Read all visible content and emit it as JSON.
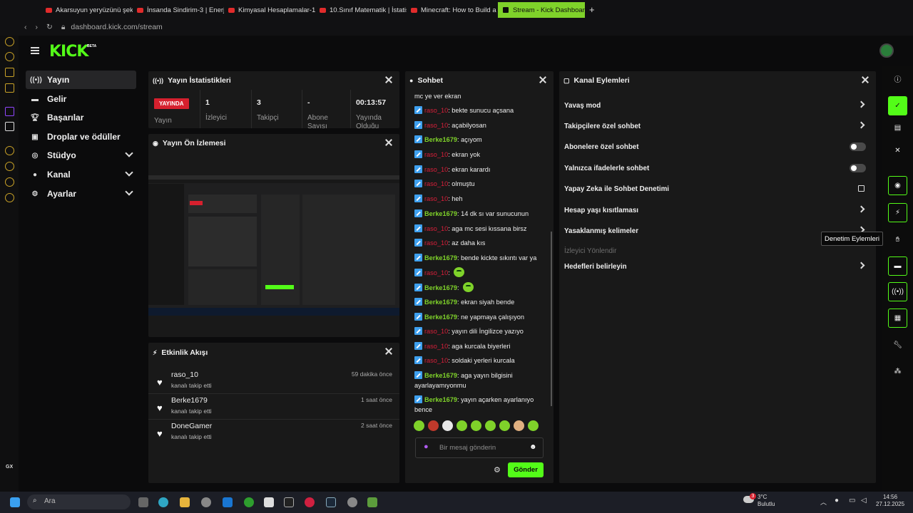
{
  "browser": {
    "tabs": [
      {
        "label": "Akarsuyun yeryüzünü şek"
      },
      {
        "label": "İnsanda Sindirim-3 | Enerj"
      },
      {
        "label": "Kimyasal Hesaplamalar-1"
      },
      {
        "label": "10.Sınıf Matematik | İstatis"
      },
      {
        "label": "Minecraft: How to Build a"
      },
      {
        "label": "Stream - Kick Dashboard"
      }
    ],
    "url": "dashboard.kick.com/stream"
  },
  "header": {
    "logo": "KICK",
    "beta": "BETA"
  },
  "sidebar": {
    "items": [
      {
        "label": "Yayın",
        "icon": "broadcast-icon"
      },
      {
        "label": "Gelir",
        "icon": "wallet-icon"
      },
      {
        "label": "Başarılar",
        "icon": "trophy-icon"
      },
      {
        "label": "Droplar ve ödüller",
        "icon": "gift-icon"
      },
      {
        "label": "Stüdyo",
        "icon": "studio-icon"
      },
      {
        "label": "Kanal",
        "icon": "user-icon"
      },
      {
        "label": "Ayarlar",
        "icon": "gear-icon"
      }
    ]
  },
  "stats": {
    "title": "Yayın İstatistikleri",
    "live": "YAYINDA",
    "live_label": "Yayın",
    "cells": [
      {
        "value": "1",
        "label": "İzleyici"
      },
      {
        "value": "3",
        "label": "Takipçi"
      },
      {
        "value": "-",
        "label": "Abone Sayısı"
      },
      {
        "value": "00:13:57",
        "label": "Yayında Olduğu"
      }
    ]
  },
  "preview": {
    "title": "Yayın Ön İzlemesi"
  },
  "activity": {
    "title": "Etkinlik Akışı",
    "items": [
      {
        "name": "raso_10",
        "sub": "kanalı takip etti",
        "time": "59 dakika önce"
      },
      {
        "name": "Berke1679",
        "sub": "kanalı takip etti",
        "time": "1 saat önce"
      },
      {
        "name": "DoneGamer",
        "sub": "kanalı takip etti",
        "time": "2 saat önce"
      }
    ]
  },
  "chat": {
    "title": "Sohbet",
    "first": "mc ye ver ekran",
    "messages": [
      {
        "user": "raso_10",
        "text": ": bekte sunucu açsana"
      },
      {
        "user": "raso_10",
        "text": ": açabilyosan"
      },
      {
        "user": "Berke1679",
        "text": ": açıyom"
      },
      {
        "user": "raso_10",
        "text": ": ekran yok"
      },
      {
        "user": "raso_10",
        "text": ": ekran karardı"
      },
      {
        "user": "raso_10",
        "text": ": olmuştu"
      },
      {
        "user": "raso_10",
        "text": ": heh"
      },
      {
        "user": "Berke1679",
        "text": ": 14 dk sı var sunucunun"
      },
      {
        "user": "raso_10",
        "text": ": aga mc sesi kıssana birsz"
      },
      {
        "user": "raso_10",
        "text": ": az daha kıs"
      },
      {
        "user": "Berke1679",
        "text": ": bende kickte sıkıntı var ya"
      },
      {
        "user": "raso_10",
        "text": ":"
      },
      {
        "user": "Berke1679",
        "text": ":"
      },
      {
        "user": "Berke1679",
        "text": ": ekran siyah bende"
      },
      {
        "user": "Berke1679",
        "text": ": ne yapmaya çalışıyon"
      },
      {
        "user": "raso_10",
        "text": ": yayın dili İngilizce yazıyo"
      },
      {
        "user": "raso_10",
        "text": ": aga kurcala biyerleri"
      },
      {
        "user": "raso_10",
        "text": ": soldaki yerleri kurcala"
      },
      {
        "user": "Berke1679",
        "text": ": aga yayın bilgisini ayarlayamıyonmu"
      },
      {
        "user": "Berke1679",
        "text": ": yayın açarken ayarlanıyo bence"
      }
    ],
    "placeholder": "Bir mesaj gönderin",
    "send": "Gönder"
  },
  "channel": {
    "title": "Kanal Eylemleri",
    "items": [
      {
        "label": "Yavaş mod",
        "control": "arrow"
      },
      {
        "label": "Takipçilere özel sohbet",
        "control": "arrow"
      },
      {
        "label": "Abonelere özel sohbet",
        "control": "toggle"
      },
      {
        "label": "Yalnızca ifadelerle sohbet",
        "control": "toggle"
      },
      {
        "label": "Yapay Zeka ile Sohbet Denetimi",
        "control": "external"
      },
      {
        "label": "Hesap yaşı kısıtlaması",
        "control": "arrow"
      },
      {
        "label": "Yasaklanmış kelimeler",
        "control": "arrow"
      },
      {
        "label": "İzleyici Yönlendir",
        "control": "none"
      },
      {
        "label": "Hedefleri belirleyin",
        "control": "arrow"
      }
    ]
  },
  "tooltip": "Denetim Eylemleri",
  "taskbar": {
    "search": "Ara",
    "weather_temp": "3°C",
    "weather_desc": "Bulutlu",
    "time": "14:56",
    "date": "27.12.2025",
    "badge": "3"
  },
  "colors": {
    "accent": "#53fc18",
    "live": "#d6202e",
    "user_red": "#d81f3a",
    "user_green": "#7fd22a"
  }
}
